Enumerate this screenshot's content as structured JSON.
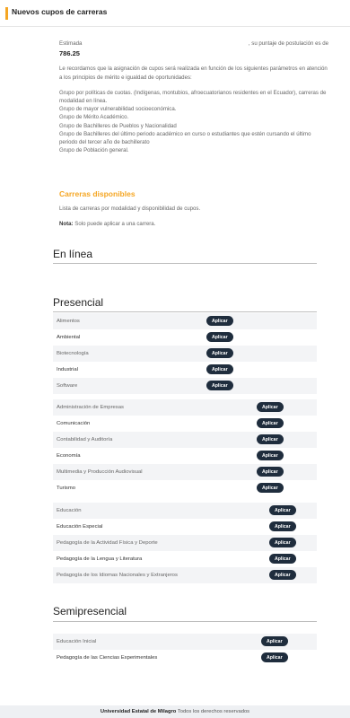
{
  "header": {
    "title": "Nuevos cupos de carreras"
  },
  "intro": {
    "greeting": "Estimada",
    "score_prefix": ", su puntaje de postulación es de",
    "score": "786.25",
    "paragraph": "Le recordamos que la asignación de cupos será realizada en función de los siguientes parámetros en atención a los principios de mérito e igualdad de oportunidades:",
    "groups": [
      "Grupo por políticas de cuotas. (Indígenas, montubios, afroecuatorianos residentes en el Ecuador), carreras de modalidad en línea.",
      "Grupo de mayor vulnerabilidad socioeconómica.",
      "Grupo de Mérito Académico.",
      "Grupo de Bachilleres de Pueblos y Nacionalidad",
      "Grupo de Bachilleres del último periodo académico en curso o estudiantes que estén cursando el último periodo del tercer año de bachillerato",
      "Grupo de Población general."
    ]
  },
  "careers": {
    "title": "Carreras disponibles",
    "description": "Lista de carreras por modalidad y disponibilidad de cupos.",
    "note_label": "Nota:",
    "note_text": " Solo puede aplicar a una carrera."
  },
  "button_label": "Aplicar",
  "modalities": {
    "online": "En línea",
    "presencial": "Presencial",
    "semipresencial": "Semipresencial"
  },
  "presencial_groups": [
    [
      "Alimentos",
      "Ambiental",
      "Biotecnología",
      "Industrial",
      "Software"
    ],
    [
      "Administración de Empresas",
      "Comunicación",
      "Contabilidad y Auditoría",
      "Economía",
      "Multimedia y Producción Audiovisual",
      "Turismo"
    ],
    [
      "Educación",
      "Educación Especial",
      "Pedagogía de la Actividad Física y Deporte",
      "Pedagogía de la Lengua y Literatura",
      "Pedagogía de los Idiomas Nacionales y Extranjeros"
    ]
  ],
  "semipresencial_careers": [
    "Educación Inicial",
    "Pedagogía de las Ciencias Experimentales"
  ],
  "footer": {
    "org": "Universidad Estatal de Milagro",
    "rights": " Todos los derechos reservados"
  }
}
